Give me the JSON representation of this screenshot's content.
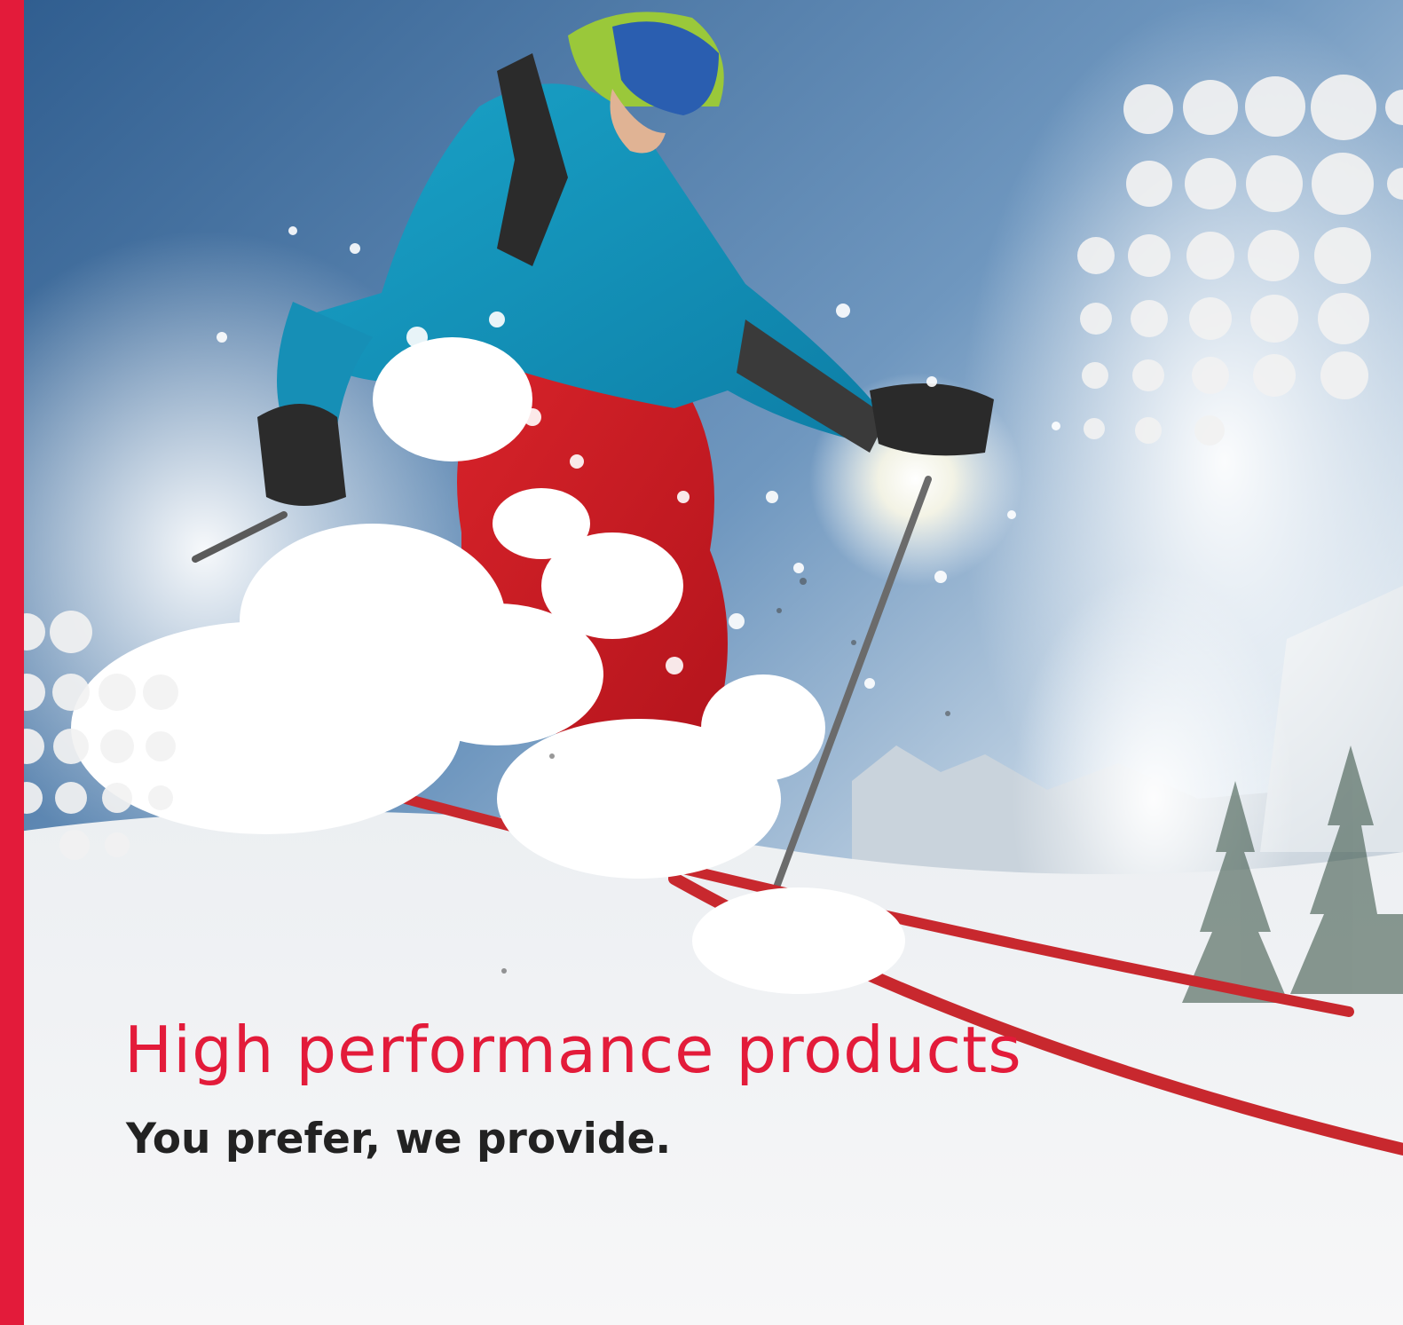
{
  "headline": "High performance products",
  "tagline": "You prefer, we provide.",
  "colors": {
    "brand_red": "#e31b3a",
    "tagline_text": "#222222",
    "dots": "#f2f2f2"
  },
  "image": {
    "subject": "skier-jumping-in-powder-snow",
    "icons": [
      "dot-pattern-top-right",
      "dot-pattern-left"
    ]
  }
}
